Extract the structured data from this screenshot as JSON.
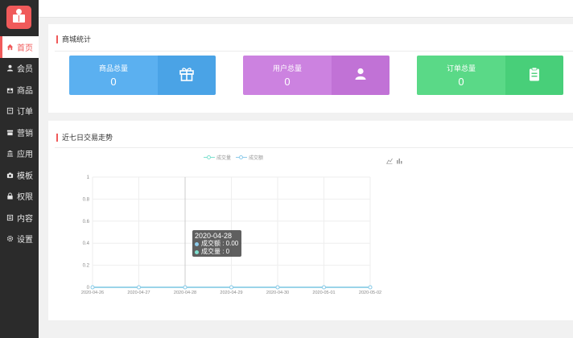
{
  "sidebar": {
    "items": [
      {
        "label": "首页",
        "icon": "home-icon",
        "active": true
      },
      {
        "label": "会员",
        "icon": "user-icon"
      },
      {
        "label": "商品",
        "icon": "gift-icon"
      },
      {
        "label": "订单",
        "icon": "order-icon"
      },
      {
        "label": "营销",
        "icon": "tag-icon"
      },
      {
        "label": "应用",
        "icon": "bank-icon"
      },
      {
        "label": "模板",
        "icon": "camera-icon"
      },
      {
        "label": "权限",
        "icon": "lock-icon"
      },
      {
        "label": "内容",
        "icon": "content-icon"
      },
      {
        "label": "设置",
        "icon": "gear-icon"
      }
    ]
  },
  "stats": {
    "title": "商城统计",
    "cards": [
      {
        "label": "商品总量",
        "value": "0",
        "color": "#5bb0f0",
        "color_dark": "#4aa3e6",
        "icon": "gift-icon"
      },
      {
        "label": "用户总量",
        "value": "0",
        "color": "#cc82e0",
        "color_dark": "#c172d6",
        "icon": "user-icon"
      },
      {
        "label": "订单总量",
        "value": "0",
        "color": "#5ad987",
        "color_dark": "#48cf79",
        "icon": "clipboard-icon"
      }
    ]
  },
  "trend": {
    "title": "近七日交易走势",
    "tooltip": {
      "date": "2020-04-28",
      "amount_line": "成交额 : 0.00",
      "count_line": "成交量 : 0"
    },
    "legend": [
      "成交量",
      "成交额"
    ]
  },
  "chart_data": {
    "type": "line",
    "x": [
      "2020-04-26",
      "2020-04-27",
      "2020-04-28",
      "2020-04-29",
      "2020-04-30",
      "2020-05-01",
      "2020-05-02"
    ],
    "series": [
      {
        "name": "成交量",
        "values": [
          0,
          0,
          0,
          0,
          0,
          0,
          0
        ],
        "color": "#7fe0d0"
      },
      {
        "name": "成交额",
        "values": [
          0,
          0,
          0,
          0,
          0,
          0,
          0
        ],
        "color": "#8ecbea"
      }
    ],
    "ylim": [
      0,
      1
    ],
    "yticks": [
      "0",
      "0.2",
      "0.4",
      "0.6",
      "0.8",
      "1"
    ],
    "grid": true,
    "legend_position": "top"
  }
}
